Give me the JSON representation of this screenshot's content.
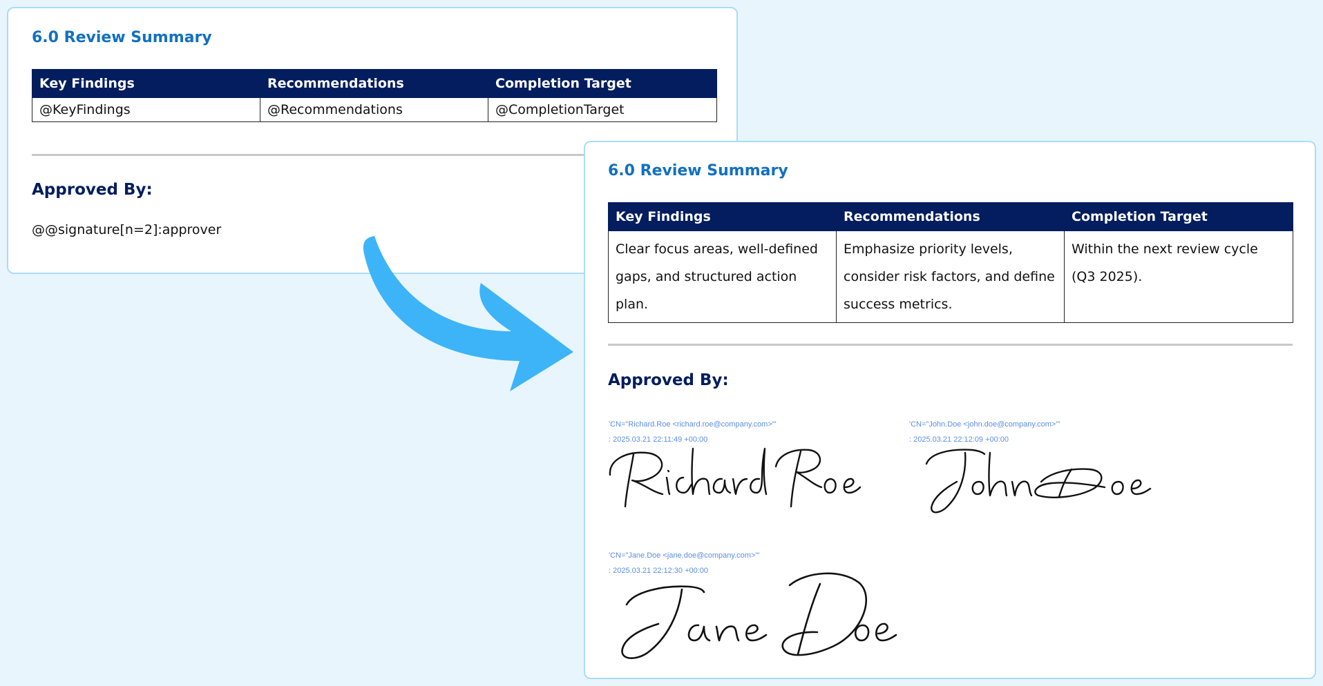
{
  "before": {
    "section_title": "6.0 Review Summary",
    "table": {
      "headers": [
        "Key Findings",
        "Recommendations",
        "Completion Target"
      ],
      "row": [
        "@KeyFindings",
        "@Recommendations",
        "@CompletionTarget"
      ]
    },
    "approved_label": "Approved By:",
    "signature_placeholder": "@@signature[n=2]:approver"
  },
  "after": {
    "section_title": "6.0 Review Summary",
    "table": {
      "headers": [
        "Key Findings",
        "Recommendations",
        "Completion Target"
      ],
      "row": [
        "Clear focus areas, well-defined gaps, and structured action plan.",
        "Emphasize priority levels, consider risk factors, and define success metrics.",
        "Within the next review cycle (Q3 2025)."
      ]
    },
    "approved_label": "Approved By:",
    "signatures": [
      {
        "cn": "'CN=\"Richard.Roe <richard.roe@company.com>\"'",
        "timestamp": ": 2025.03.21 22:11:49 +00:00",
        "signature_name": "Richard Roe"
      },
      {
        "cn": "'CN=\"John.Doe <john.doe@company.com>\"'",
        "timestamp": ": 2025.03.21 22:12:09 +00:00",
        "signature_name": "John Doe"
      },
      {
        "cn": "'CN=\"Jane.Doe <jane.doe@company.com>\"'",
        "timestamp": ": 2025.03.21 22:12:30 +00:00",
        "signature_name": "Jane Doe"
      }
    ]
  },
  "colors": {
    "page_background": "#e8f5fd",
    "card_border": "#a9dcf7",
    "title_blue": "#1270c0",
    "header_navy": "#031d5e",
    "arrow_blue": "#3db4f8",
    "signature_meta_blue": "#5b8ee0"
  },
  "icons": {
    "transition_arrow": "curved-arrow-right-icon"
  }
}
